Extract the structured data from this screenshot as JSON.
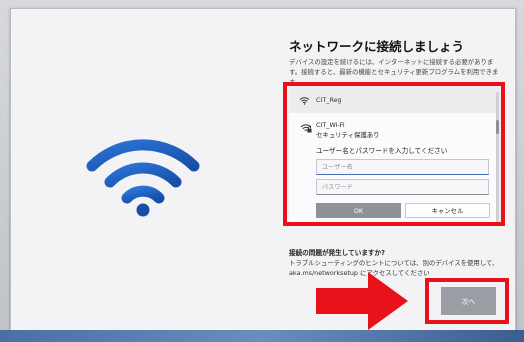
{
  "page": {
    "title": "ネットワークに接続しましょう",
    "description": "デバイスの設定を続けるには、インターネットに接続する必要があります。接続すると、最新の機能とセキュリティ更新プログラムを利用できます。"
  },
  "networks": [
    {
      "name": "CIT_Reg",
      "icon": "wifi-icon"
    },
    {
      "name": "CIT_Wi-Fi",
      "security": "セキュリティ保護あり",
      "icon": "wifi-lock-icon",
      "prompt": "ユーザー名とパスワードを入力してください",
      "username": {
        "value": "",
        "placeholder": "ユーザー名"
      },
      "password": {
        "value": "",
        "placeholder": "パスワード"
      },
      "ok_label": "OK",
      "cancel_label": "キャンセル"
    }
  ],
  "help": {
    "title": "接続の問題が発生していますか?",
    "text": "トラブルシューティングのヒントについては、別のデバイスを使用して、aka.ms/networksetup にアクセスしてください"
  },
  "next_label": "次へ",
  "colors": {
    "highlight": "#e8121b",
    "wifi_illustration": "#1f5fbf",
    "ok_button": "#8f9399",
    "next_button": "#9a9da3"
  }
}
